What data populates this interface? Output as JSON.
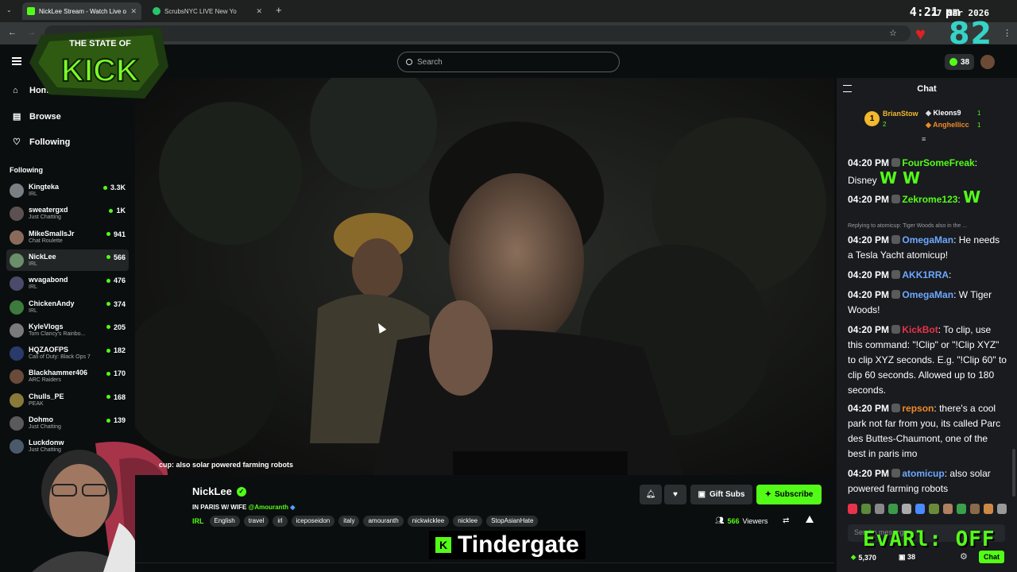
{
  "browser": {
    "tabs": [
      {
        "title": "NickLee Stream - Watch Live o",
        "active": true
      },
      {
        "title": "ScrubsNYC LIVE New Yo",
        "active": false
      }
    ],
    "clock": "4:21 pm",
    "date": "27 Mar 2026"
  },
  "overlay": {
    "logo_text": "THE STATE OF KICK",
    "big_counter": "82",
    "caption": "Tindergate",
    "bottom_right_text": "EvARl: OFF"
  },
  "header": {
    "search_placeholder": "Search",
    "points": "38"
  },
  "sidebar": {
    "nav": [
      {
        "label": "Home",
        "icon": "home-icon"
      },
      {
        "label": "Browse",
        "icon": "browse-icon"
      },
      {
        "label": "Following",
        "icon": "heart-icon"
      }
    ],
    "following_title": "Following",
    "channels": [
      {
        "name": "Kingteka",
        "category": "IRL",
        "viewers": "3.3K",
        "color": "#7a7f83"
      },
      {
        "name": "sweatergxd",
        "category": "Just Chatting",
        "viewers": "1K",
        "color": "#5c5050"
      },
      {
        "name": "MikeSmallsJr",
        "category": "Chat Roulette",
        "viewers": "941",
        "color": "#8a6b5a"
      },
      {
        "name": "NickLee",
        "category": "IRL",
        "viewers": "566",
        "color": "#6a8f6a",
        "selected": true
      },
      {
        "name": "wvagabond",
        "category": "IRL",
        "viewers": "476",
        "color": "#4a4a6a"
      },
      {
        "name": "ChickenAndy",
        "category": "IRL",
        "viewers": "374",
        "color": "#3d7a3d"
      },
      {
        "name": "KyleVlogs",
        "category": "Tom Clancy's Rainbo...",
        "viewers": "205",
        "color": "#7a7a7a"
      },
      {
        "name": "HQZAOFPS",
        "category": "Call of Duty: Black Ops 7",
        "viewers": "182",
        "color": "#2a3a6a"
      },
      {
        "name": "Blackhammer406",
        "category": "ARC Raiders",
        "viewers": "170",
        "color": "#6a4a3a"
      },
      {
        "name": "Chulls_PE",
        "category": "PEAK",
        "viewers": "168",
        "color": "#8a7a3a"
      },
      {
        "name": "Dohmo",
        "category": "Just Chatting",
        "viewers": "139",
        "color": "#5a5a5a"
      },
      {
        "name": "Luckdonw",
        "category": "Just Chatting",
        "viewers": "",
        "color": "#4a5a6a"
      }
    ]
  },
  "stream": {
    "chat_overlay_line": "cup: also solar powered farming robots",
    "name": "NickLee",
    "title_prefix": "IN PARIS W/ WIFE",
    "title_mention": "@Amouranth",
    "category": "IRL",
    "tags": [
      "English",
      "travel",
      "irl",
      "iceposeidon",
      "italy",
      "amouranth",
      "nickwicklee",
      "nicklee",
      "StopAsianHate"
    ],
    "viewers": "566",
    "viewers_label": "Viewers",
    "gift_label": "Gift Subs",
    "subscribe_label": "Subscribe"
  },
  "chat": {
    "title": "Chat",
    "gifters": [
      {
        "name": "BrianStow",
        "count": "2"
      },
      {
        "name": "Kleons9",
        "count": "1"
      },
      {
        "name": "Anghellicc",
        "count": "1"
      }
    ],
    "reply_line": "Replying to atomicup: Tiger Woods also in the ...",
    "messages": [
      {
        "time": "04:20 PM",
        "user": "FourSomeFreak",
        "color": "#53fc18",
        "text": "Disney",
        "emote": "W W"
      },
      {
        "time": "04:20 PM",
        "user": "Zekrome123",
        "color": "#53fc18",
        "text": "",
        "emote": "W"
      },
      {
        "time": "04:20 PM",
        "user": "OmegaMan",
        "color": "#6ea8ff",
        "text": "He needs a Tesla Yacht atomicup!"
      },
      {
        "time": "04:20 PM",
        "user": "AKK1RRA",
        "color": "#6ea8ff",
        "text": ""
      },
      {
        "time": "04:20 PM",
        "user": "OmegaMan",
        "color": "#6ea8ff",
        "text": "W Tiger Woods!"
      },
      {
        "time": "04:20 PM",
        "user": "KickBot",
        "color": "#e8334a",
        "text": "To clip, use this command: \"!Clip\" or \"!Clip XYZ\" to clip XYZ seconds. E.g. \"!Clip 60\" to clip 60 seconds. Allowed up to 180 seconds."
      },
      {
        "time": "04:20 PM",
        "user": "repson",
        "color": "#f08a24",
        "text": "there's a cool park not far from you, its called Parc des Buttes-Chaumont, one of the best in paris imo"
      },
      {
        "time": "04:20 PM",
        "user": "atomicup",
        "color": "#6ea8ff",
        "text": "also solar powered farming robots"
      }
    ],
    "input_placeholder": "Send a message",
    "footer_points": "5,370",
    "footer_subs": "38",
    "chat_button": "Chat"
  }
}
